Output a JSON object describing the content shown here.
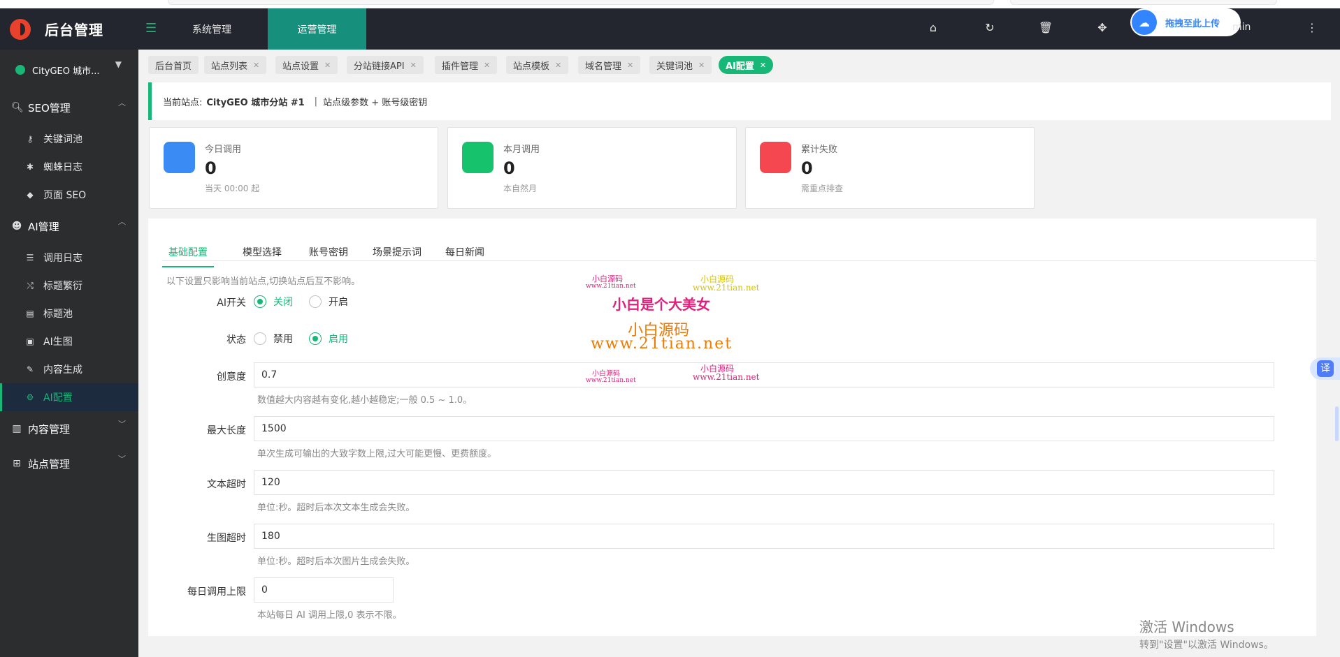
{
  "brand": {
    "title": "后台管理"
  },
  "site_selector": {
    "label": "CityGEO 城市..."
  },
  "sidebar": {
    "groups": [
      {
        "label": "SEO管理",
        "icon": "search-icon",
        "expanded": true,
        "items": [
          {
            "label": "关键词池",
            "icon": "key-icon"
          },
          {
            "label": "蜘蛛日志",
            "icon": "bug-icon"
          },
          {
            "label": "页面 SEO",
            "icon": "tag-icon"
          }
        ]
      },
      {
        "label": "AI管理",
        "icon": "robot-icon",
        "expanded": true,
        "items": [
          {
            "label": "调用日志",
            "icon": "list-icon"
          },
          {
            "label": "标题繁衍",
            "icon": "shuffle-icon"
          },
          {
            "label": "标题池",
            "icon": "card-icon"
          },
          {
            "label": "AI生图",
            "icon": "image-icon"
          },
          {
            "label": "内容生成",
            "icon": "pencil-icon"
          },
          {
            "label": "AI配置",
            "icon": "gear-icon",
            "active": true
          }
        ]
      },
      {
        "label": "内容管理",
        "icon": "book-icon",
        "expanded": false,
        "items": []
      },
      {
        "label": "站点管理",
        "icon": "sitemap-icon",
        "expanded": false,
        "items": []
      }
    ]
  },
  "header": {
    "nav_tabs": [
      {
        "label": "系统管理",
        "active": false
      },
      {
        "label": "运营管理",
        "active": true
      }
    ],
    "icons": [
      "home-icon",
      "refresh-icon",
      "trash-icon",
      "move-icon",
      "more-icon"
    ],
    "upload_pill": "拖拽至此上传",
    "user": "min"
  },
  "page_tabs": [
    {
      "label": "后台首页",
      "closable": false
    },
    {
      "label": "站点列表",
      "closable": true
    },
    {
      "label": "站点设置",
      "closable": true
    },
    {
      "label": "分站链接API",
      "closable": true
    },
    {
      "label": "插件管理",
      "closable": true
    },
    {
      "label": "站点模板",
      "closable": true
    },
    {
      "label": "域名管理",
      "closable": true
    },
    {
      "label": "关键词池",
      "closable": true
    },
    {
      "label": "AI配置",
      "closable": true,
      "active": true
    }
  ],
  "notice": {
    "prefix": "当前站点:",
    "site": "CityGEO 城市分站 #1",
    "sep": "|",
    "suffix": "站点级参数 + 账号级密钥"
  },
  "stats": [
    {
      "label": "今日调用",
      "value": "0",
      "sub": "当天 00:00 起",
      "color": "#3b8bf5"
    },
    {
      "label": "本月调用",
      "value": "0",
      "sub": "本自然月",
      "color": "#16c26b"
    },
    {
      "label": "累计失败",
      "value": "0",
      "sub": "需重点排查",
      "color": "#f5474f"
    }
  ],
  "form_tabs": [
    {
      "label": "基础配置",
      "active": true
    },
    {
      "label": "模型选择"
    },
    {
      "label": "账号密钥"
    },
    {
      "label": "场景提示词"
    },
    {
      "label": "每日新闻"
    }
  ],
  "form": {
    "intro": "以下设置只影响当前站点,切换站点后互不影响。",
    "ai_switch": {
      "label": "AI开关",
      "options": [
        "关闭",
        "开启"
      ],
      "selected": "关闭"
    },
    "status": {
      "label": "状态",
      "options": [
        "禁用",
        "启用"
      ],
      "selected": "启用"
    },
    "creativity": {
      "label": "创意度",
      "value": "0.7",
      "help": "数值越大内容越有变化,越小越稳定;一般 0.5 ~ 1.0。"
    },
    "max_length": {
      "label": "最大长度",
      "value": "1500",
      "help": "单次生成可输出的大致字数上限,过大可能更慢、更费额度。"
    },
    "text_timeout": {
      "label": "文本超时",
      "value": "120",
      "help": "单位:秒。超时后本次文本生成会失败。"
    },
    "image_timeout": {
      "label": "生图超时",
      "value": "180",
      "help": "单位:秒。超时后本次图片生成会失败。"
    },
    "daily_limit": {
      "label": "每日调用上限",
      "value": "0",
      "help": "本站每日 AI 调用上限,0 表示不限。"
    }
  },
  "watermark": {
    "a1": "小白源码",
    "a2": "www.21tian.net",
    "b1": "小白源码",
    "b2": "www.21tian.net",
    "main": "小白是个大美女",
    "mid": "小白源码",
    "url": "www.21tian.net",
    "c1": "小白源码",
    "c2": "www.21tian.net",
    "d1": "小白源码",
    "d2": "www.21tian.net"
  },
  "windows_activation": {
    "line1": "激活 Windows",
    "line2": "转到\"设置\"以激活 Windows。"
  },
  "translate_button": "译",
  "colors": {
    "accent": "#16b777",
    "sidebar": "#2b2d2f",
    "header": "#23262e"
  }
}
